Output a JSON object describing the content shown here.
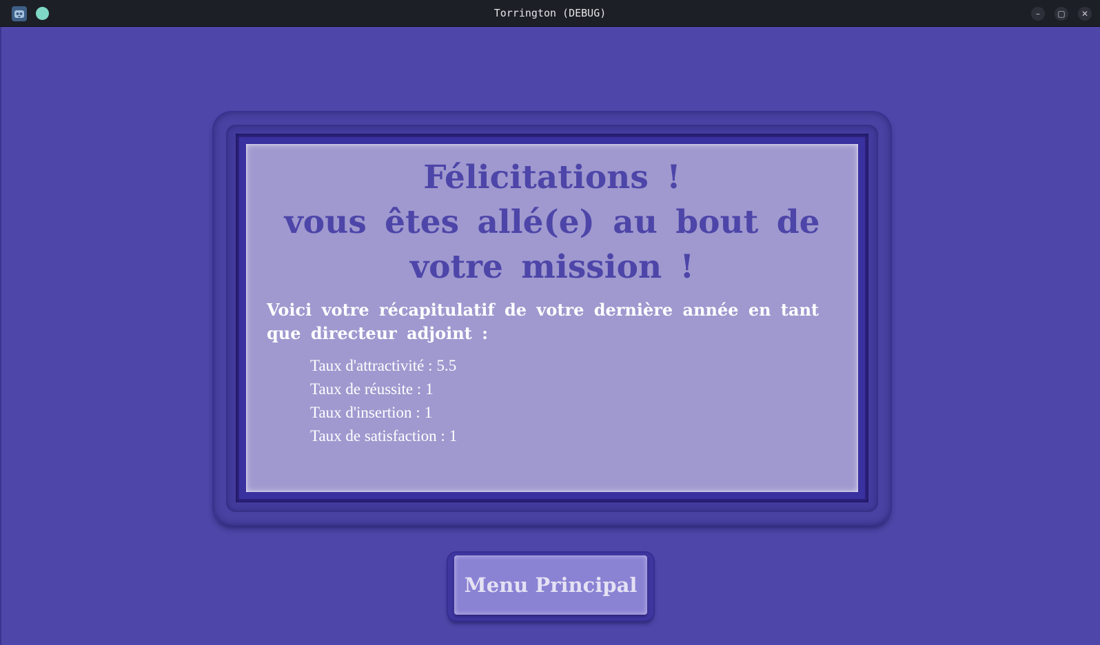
{
  "window": {
    "title": "Torrington (DEBUG)",
    "minimize_glyph": "–",
    "maximize_glyph": "▢",
    "close_glyph": "✕",
    "icons": {
      "app": "godot-engine-icon",
      "status": "status-dot-icon"
    }
  },
  "end_screen": {
    "headline": "Félicitations !\nvous êtes allé(e) au bout de\nvotre mission !",
    "intro": "Voici votre récapitulatif de votre dernière année en tant que directeur adjoint :",
    "stats": [
      {
        "label": "Taux d'attractivité :",
        "value": "5.5"
      },
      {
        "label": "Taux de réussite :",
        "value": "1"
      },
      {
        "label": "Taux d'insertion :",
        "value": "1"
      },
      {
        "label": "Taux de satisfaction :",
        "value": "1"
      }
    ]
  },
  "buttons": {
    "main_menu": "Menu Principal"
  },
  "colors": {
    "background": "#4e46a8",
    "panel": "#9f99cf",
    "headline": "#4d45a8",
    "button": "#8a82d3",
    "titlebar": "#1d1f26"
  }
}
